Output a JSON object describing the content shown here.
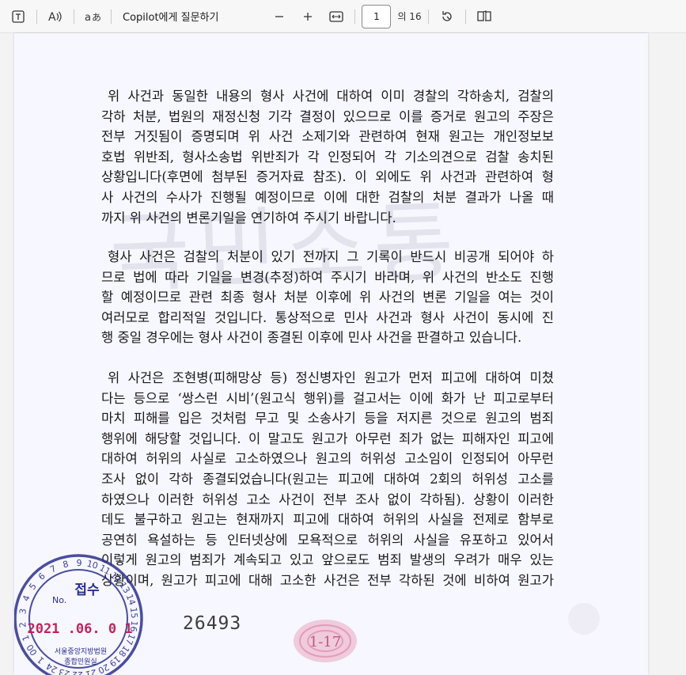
{
  "toolbar": {
    "ask_copilot": "Copilot에게 질문하기",
    "page_value": "1",
    "page_total": "의 16"
  },
  "document": {
    "paragraphs": [
      [
        "위 사건과 동일한 내용의 형사 사건에 대하여 이미 경찰의 각하송치, 검찰의",
        "각하 처분, 법원의 재정신청 기각 결정이 있으므로 이를 증거로 원고의 주장은",
        "전부 거짓됨이 증명되며 위 사건 소제기와 관련하여 현재 원고는 개인정보보",
        "호법 위반죄, 형사소송법 위반죄가 각 인정되어 각 기소의견으로 검찰 송치된",
        "상황입니다(후면에 첨부된 증거자료 참조). 이 외에도 위 사건과 관련하여 형",
        "사 사건의 수사가 진행될 예정이므로 이에 대한 검찰의 처분 결과가 나올 때",
        "까지 위 사건의 변론기일을 연기하여 주시기 바랍니다."
      ],
      [
        "형사 사건은 검찰의 처분이 있기 전까지 그 기록이 반드시 비공개 되어야 하",
        "므로 법에 따라 기일을 변경(추정)하여 주시기 바라며, 위 사건의 반소도 진행",
        "할 예정이므로 관련 최종 형사 처분 이후에 위 사건의 변론 기일을 여는 것이",
        "여러모로 합리적일 것입니다. 통상적으로 민사 사건과 형사 사건이 동시에 진",
        "행 중일 경우에는 형사 사건이 종결된 이후에 민사 사건을 판결하고 있습니다."
      ],
      [
        "위 사건은 조현병(피해망상 등) 정신병자인 원고가 먼저 피고에 대하여 미쳤",
        "다는 등으로 ‘쌍스런 시비’(원고식 행위)를 걸고서는 이에 화가 난 피고로부터",
        "마치 피해를 입은 것처럼 무고 및 소송사기 등을 저지른 것으로 원고의 범죄",
        "행위에 해당할 것입니다. 이 말고도 원고가 아무런 죄가 없는 피해자인 피고에",
        "대하여 허위의 사실로 고소하였으나 원고의 허위성 고소임이 인정되어 아무런",
        "조사 없이 각하 종결되었습니다(원고는 피고에 대하여 2회의 허위성 고소를",
        "하였으나 이러한 허위성 고소 사건이 전부 조사 없이 각하됨). 상황이 이러한",
        "데도 불구하고 원고는 현재까지 피고에 대하여 허위의 사실을 전제로 함부로",
        "공연히 욕설하는 등 인터넷상에 모욕적으로 허위의 사실을 유포하고 있어서",
        "이렇게 원고의 범죄가 계속되고 있고 앞으로도 범죄 발생의 우려가 매우 있는",
        "상황이며, 원고가 피고에 대해 고소한 사건은 전부 각하된 것에 비하여 원고가"
      ]
    ],
    "watermark": "국민소통",
    "doc_number": "26493",
    "fingerprint_mark": "1-17",
    "stamp": {
      "title": "접수",
      "no_label": "No.",
      "date": "2021 .06. 0 1",
      "court_line1": "서울중앙지방법원",
      "court_line2": "종합민원실",
      "ring_numbers": [
        "1",
        "2",
        "3",
        "4",
        "5",
        "6",
        "7",
        "8",
        "9",
        "10",
        "11",
        "12",
        "13",
        "14",
        "15",
        "16",
        "17",
        "18",
        "19",
        "20",
        "21",
        "22",
        "23",
        "24",
        "1",
        "00"
      ],
      "color": "#2b2f8f"
    },
    "page_bg_color": "#f7f7ff"
  }
}
